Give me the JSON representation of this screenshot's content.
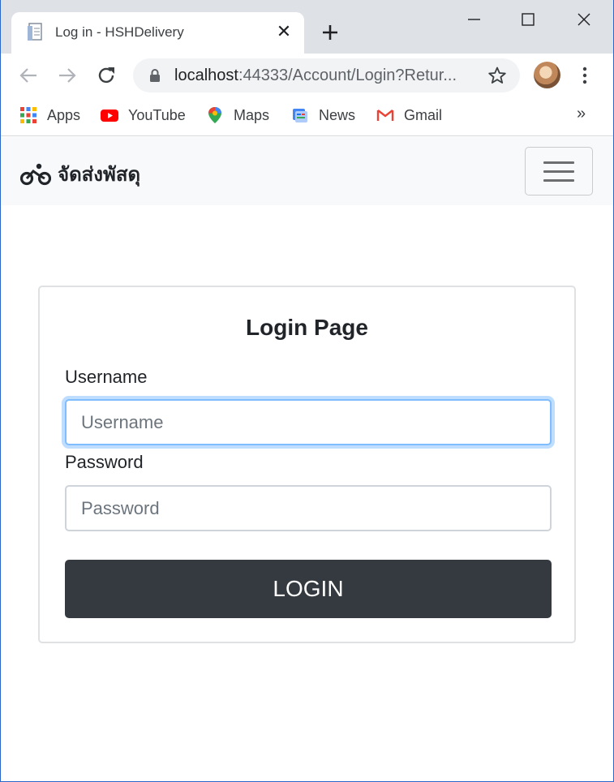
{
  "browser": {
    "tab_title": "Log in - HSHDelivery",
    "url_host": "localhost",
    "url_rest": ":44333/Account/Login?Retur...",
    "window_controls": [
      "minimize-icon",
      "maximize-icon",
      "close-icon"
    ]
  },
  "bookmarks": {
    "items": [
      {
        "label": "Apps",
        "icon": "apps-grid-icon"
      },
      {
        "label": "YouTube",
        "icon": "youtube-icon"
      },
      {
        "label": "Maps",
        "icon": "maps-pin-icon"
      },
      {
        "label": "News",
        "icon": "news-icon"
      },
      {
        "label": "Gmail",
        "icon": "gmail-icon"
      }
    ],
    "more": "»"
  },
  "navbar": {
    "brand": "จัดส่งพัสดุ",
    "brand_icon": "bicycle-icon"
  },
  "login": {
    "title": "Login Page",
    "username_label": "Username",
    "username_placeholder": "Username",
    "password_label": "Password",
    "password_placeholder": "Password",
    "submit_label": "LOGIN"
  },
  "colors": {
    "button_bg": "#343a40",
    "navbar_bg": "#f8f9fa",
    "focus_ring": "#80bdff"
  }
}
